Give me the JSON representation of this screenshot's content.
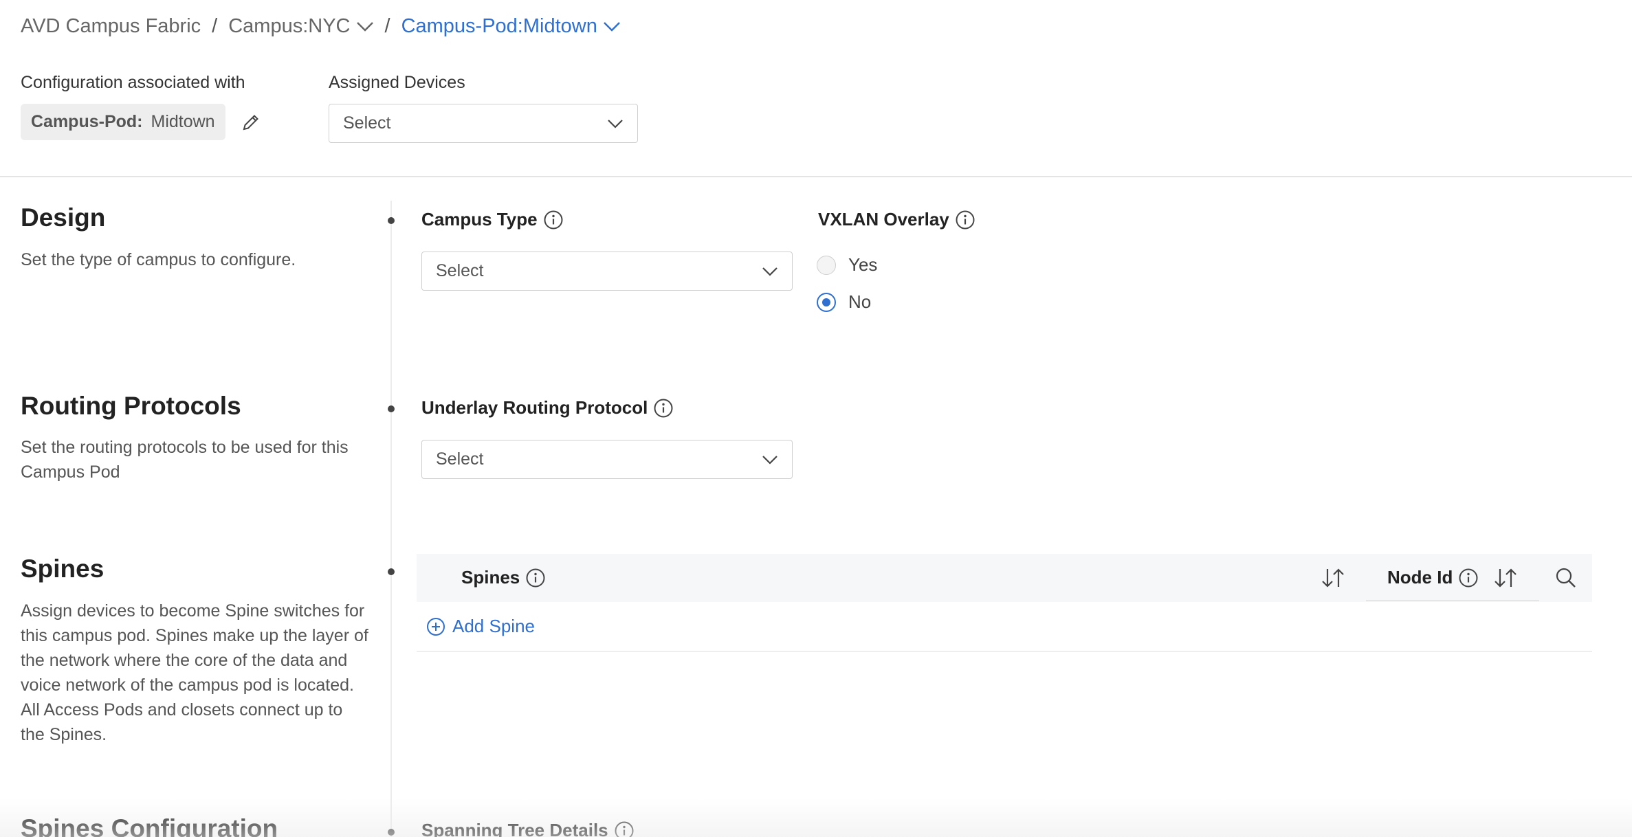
{
  "breadcrumb": {
    "root": "AVD Campus Fabric",
    "separator": "/",
    "campus": "Campus:NYC",
    "pod": "Campus-Pod:Midtown"
  },
  "association": {
    "label": "Configuration associated with",
    "chip_key": "Campus-Pod:",
    "chip_value": "Midtown"
  },
  "assigned_devices": {
    "label": "Assigned Devices",
    "value": "Select"
  },
  "design": {
    "title": "Design",
    "description": "Set the type of campus to configure.",
    "campus_type": {
      "label": "Campus Type",
      "value": "Select"
    },
    "vxlan_overlay": {
      "label": "VXLAN Overlay",
      "options": [
        "Yes",
        "No"
      ],
      "selected": "No"
    }
  },
  "routing": {
    "title": "Routing Protocols",
    "description": "Set the routing protocols to be used for this Campus Pod",
    "underlay": {
      "label": "Underlay Routing Protocol",
      "value": "Select"
    }
  },
  "spines": {
    "title": "Spines",
    "description": "Assign devices to become Spine switches for this campus pod. Spines make up the layer of the network where the core of the data and voice network of the campus pod is located. All Access Pods and closets connect up to the Spines.",
    "columns": [
      "Spines",
      "Node Id"
    ],
    "add_label": "Add Spine"
  },
  "spines_config": {
    "title": "Spines Configuration",
    "spanning_tree": {
      "label": "Spanning Tree Details"
    }
  },
  "colors": {
    "accent": "#2f6fd0",
    "text": "#222222",
    "muted": "#555555"
  },
  "icons": [
    "chevron-down-icon",
    "pencil-icon",
    "info-icon",
    "sort-icon",
    "search-icon",
    "plus-circle-icon"
  ]
}
